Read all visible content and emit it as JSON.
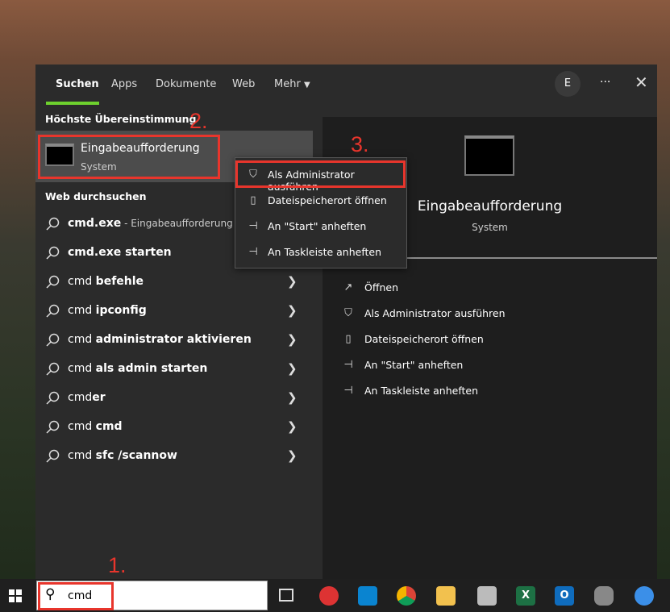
{
  "tabs": [
    {
      "label": "Suchen"
    },
    {
      "label": "Apps"
    },
    {
      "label": "Dokumente"
    },
    {
      "label": "Web"
    },
    {
      "label": "Mehr"
    }
  ],
  "account_initial": "E",
  "more_options": "···",
  "best_match": {
    "heading": "Höchste Übereinstimmung",
    "title": "Eingabeaufforderung",
    "subtitle": "System"
  },
  "web": {
    "heading": "Web durchsuchen",
    "items": [
      {
        "bold": "cmd.exe",
        "rest": " - Eingabeaufforderung",
        "chevron": false
      },
      {
        "bold": "cmd.exe starten",
        "rest": "",
        "chevron": false
      },
      {
        "pre": "cmd ",
        "bold": "befehle",
        "chevron": true
      },
      {
        "pre": "cmd ",
        "bold": "ipconfig",
        "chevron": true
      },
      {
        "pre": "cmd ",
        "bold": "administrator aktivieren",
        "chevron": true
      },
      {
        "pre": "cmd ",
        "bold": "als admin starten",
        "chevron": true
      },
      {
        "pre": "cmd",
        "bold": "er",
        "chevron": true
      },
      {
        "pre": "cmd ",
        "bold": "cmd",
        "chevron": true
      },
      {
        "pre": "cmd ",
        "bold": "sfc /scannow",
        "chevron": true
      }
    ]
  },
  "context_menu": [
    {
      "icon": "shield-icon",
      "label": "Als Administrator ausführen"
    },
    {
      "icon": "folder-icon",
      "label": "Dateispeicherort öffnen"
    },
    {
      "icon": "pin-icon",
      "label": "An \"Start\" anheften"
    },
    {
      "icon": "pin-icon",
      "label": "An Taskleiste anheften"
    }
  ],
  "preview": {
    "title": "Eingabeaufforderung",
    "subtitle": "System",
    "actions": [
      {
        "icon": "open-icon",
        "label": "Öffnen"
      },
      {
        "icon": "shield-icon",
        "label": "Als Administrator ausführen"
      },
      {
        "icon": "folder-icon",
        "label": "Dateispeicherort öffnen"
      },
      {
        "icon": "pin-icon",
        "label": "An \"Start\" anheften"
      },
      {
        "icon": "pin-icon",
        "label": "An Taskleiste anheften"
      }
    ]
  },
  "annotations": {
    "step1": "1.",
    "step2": "2.",
    "step3": "3."
  },
  "search": {
    "value": "cmd"
  },
  "accent": "#6ed12e",
  "annotation_color": "#e8352c"
}
